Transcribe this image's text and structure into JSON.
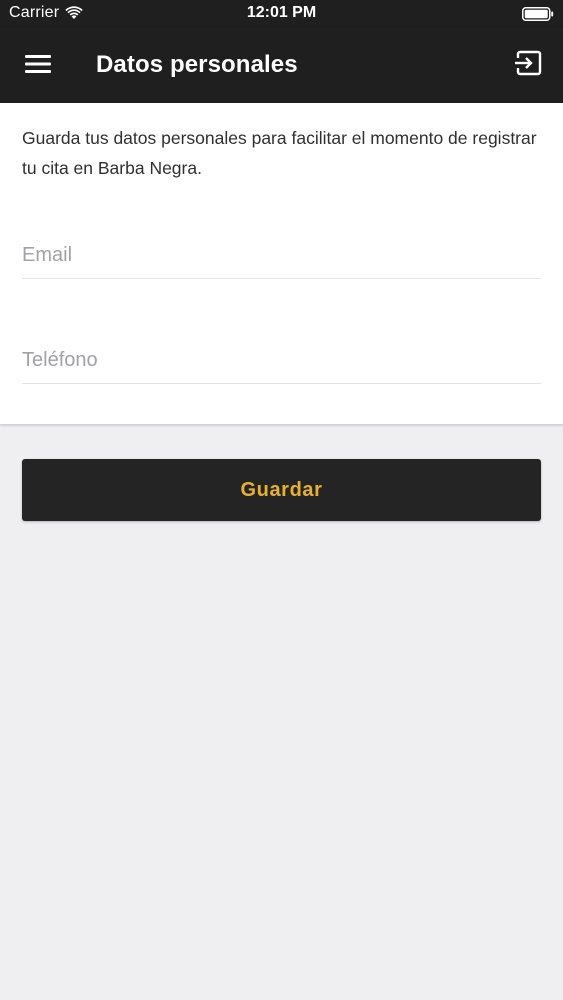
{
  "status_bar": {
    "carrier": "Carrier",
    "time": "12:01 PM",
    "icons": [
      "wifi-icon",
      "battery-icon"
    ]
  },
  "header": {
    "title": "Datos personales",
    "menu_icon": "hamburger-menu-icon",
    "logout_icon": "exit-icon",
    "background": "#1f1f1f"
  },
  "form": {
    "intro": "Guarda tus datos personales para facilitar el momento de registrar tu cita en Barba Negra.",
    "email_placeholder": "Email",
    "email_value": "",
    "phone_placeholder": "Teléfono",
    "phone_value": ""
  },
  "actions": {
    "save_label": "Guardar",
    "save_label_color": "#e8b12d",
    "save_background": "#242424"
  },
  "colors": {
    "page_background": "#efeef0",
    "card_background": "#ffffff"
  }
}
